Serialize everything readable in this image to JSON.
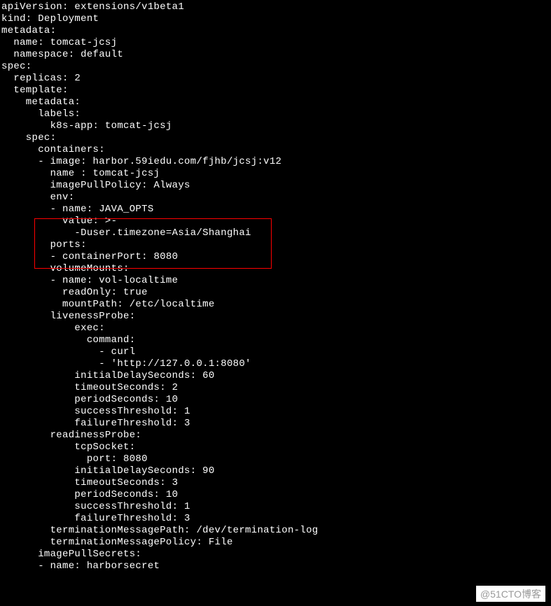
{
  "lines": [
    "apiVersion: extensions/v1beta1",
    "kind: Deployment",
    "metadata:",
    "  name: tomcat-jcsj",
    "  namespace: default",
    "spec:",
    "  replicas: 2",
    "  template:",
    "    metadata:",
    "      labels:",
    "        k8s-app: tomcat-jcsj",
    "    spec:",
    "      containers:",
    "      - image: harbor.59iedu.com/fjhb/jcsj:v12",
    "        name : tomcat-jcsj",
    "        imagePullPolicy: Always",
    "        env:",
    "        - name: JAVA_OPTS",
    "          value: >-",
    "            -Duser.timezone=Asia/Shanghai",
    "        ports:",
    "        - containerPort: 8080",
    "        volumeMounts:",
    "        - name: vol-localtime",
    "          readOnly: true",
    "          mountPath: /etc/localtime",
    "        livenessProbe:",
    "            exec:",
    "              command:",
    "                - curl",
    "                - 'http://127.0.0.1:8080'",
    "            initialDelaySeconds: 60",
    "            timeoutSeconds: 2",
    "            periodSeconds: 10",
    "            successThreshold: 1",
    "            failureThreshold: 3",
    "        readinessProbe:",
    "            tcpSocket:",
    "              port: 8080",
    "            initialDelaySeconds: 90",
    "            timeoutSeconds: 3",
    "            periodSeconds: 10",
    "            successThreshold: 1",
    "            failureThreshold: 3",
    "        terminationMessagePath: /dev/termination-log",
    "        terminationMessagePolicy: File",
    "      imagePullSecrets:",
    "      - name: harborsecret"
  ],
  "watermark": "@51CTO博客"
}
